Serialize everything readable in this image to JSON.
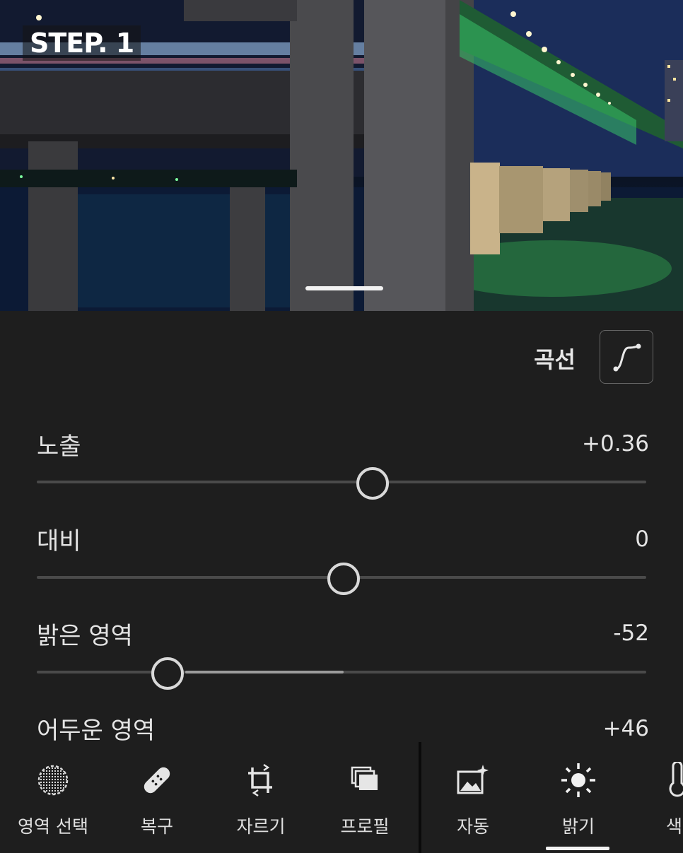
{
  "photo": {
    "step_label": "STEP. 1"
  },
  "curve": {
    "label": "곡선"
  },
  "adjustments": [
    {
      "label": "노출",
      "value": "+0.36",
      "level": 0.5
    },
    {
      "label": "대비",
      "value": "0",
      "level": 0.5
    },
    {
      "label": "밝은 영역",
      "value": "-52",
      "level": 0.24
    },
    {
      "label": "어두운 영역",
      "value": "+46"
    }
  ],
  "toolbar": {
    "tools": [
      {
        "label": "영역 선택",
        "icon": "selective-icon"
      },
      {
        "label": "복구",
        "icon": "bandage-icon"
      },
      {
        "label": "자르기",
        "icon": "crop-icon"
      },
      {
        "label": "프로필",
        "icon": "profile-icon"
      },
      {
        "label": "자동",
        "icon": "auto-icon"
      },
      {
        "label": "밝기",
        "icon": "sun-icon",
        "active": true
      },
      {
        "label": "색",
        "icon": "thermometer-icon"
      }
    ]
  }
}
